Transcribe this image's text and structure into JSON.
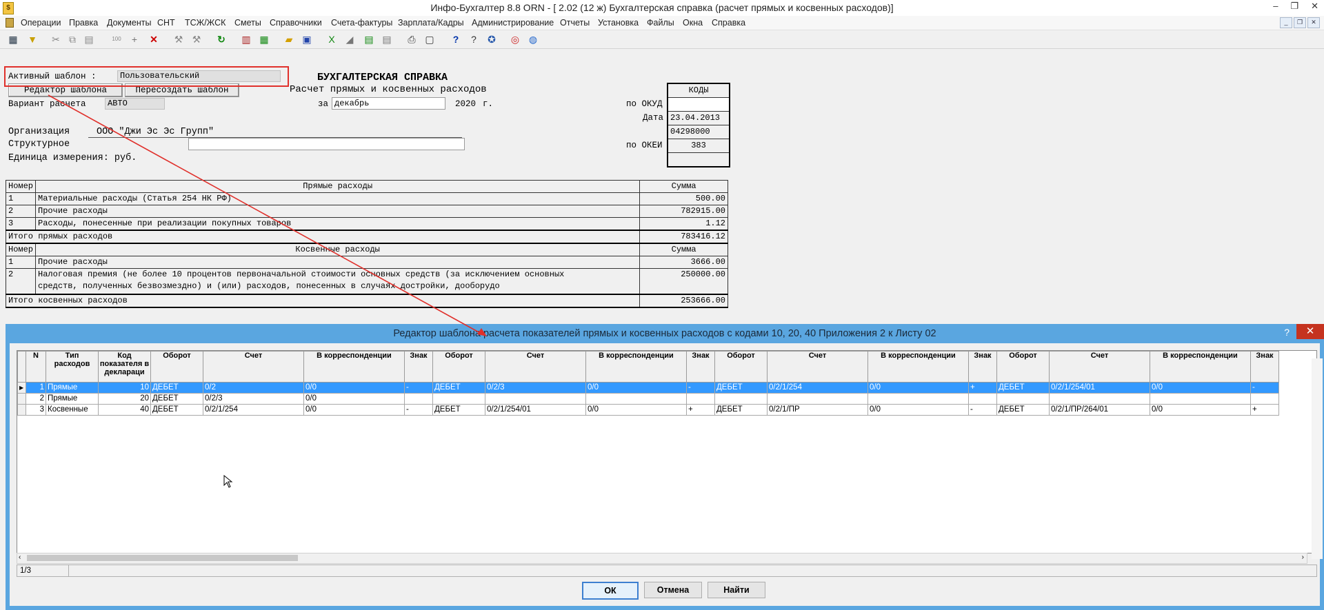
{
  "window": {
    "title": "Инфо-Бухгалтер 8.8   ORN   - [      2.02 (12 ж) Бухгалтерская справка (расчет прямых и косвенных расходов)]",
    "app_icon": "ledger-icon",
    "controls": [
      "_",
      "❐",
      "✕"
    ]
  },
  "menu": [
    "Операции",
    "Правка",
    "Документы",
    "СНТ",
    "ТСЖ/ЖСК",
    "Сметы",
    "Справочники",
    "Счета-фактуры",
    "Зарплата/Кадры",
    "Администрирование",
    "Отчеты",
    "Установка",
    "Файлы",
    "Окна",
    "Справка"
  ],
  "toolbar_icons": [
    "calc-icon",
    "filter-icon",
    "cut-icon",
    "copy-icon",
    "paste-icon",
    "number-icon",
    "add-icon",
    "delete-icon",
    "tool1-icon",
    "tool2-icon",
    "refresh-icon",
    "report-icon",
    "table-icon",
    "open-icon",
    "save-icon",
    "excel-icon",
    "chart-icon",
    "export-icon",
    "export2-icon",
    "print-icon",
    "preview-icon",
    "help-icon",
    "context-help-icon",
    "navigate-icon",
    "support-icon",
    "web-icon"
  ],
  "doc": {
    "template_label": "Активный шаблон :",
    "template_value": "Пользовательский",
    "btn_editor": "Редактор шаблона",
    "btn_recreate": "Пересоздать шаблон",
    "variant_label": "Вариант расчета",
    "variant_value": "АВТО",
    "heading": "БУХГАЛТЕРСКАЯ СПРАВКА",
    "subheading": "Расчет прямых и косвенных расходов",
    "period_prefix": "за",
    "period_month": "декабрь",
    "period_year": "2020",
    "period_suffix": "г.",
    "codes_header": "КОДЫ",
    "okud_label": "по ОКУД",
    "okud_value": "",
    "date_label": "Дата",
    "date_value": "23.04.2013",
    "code3_value": "04298000",
    "okei_label": "по ОКЕИ",
    "okei_value": "383",
    "org_label": "Организация",
    "org_value": "ООО \"Джи Эс Эс Групп\"",
    "struct_label": "Структурное",
    "unit_label": "Единица измерения: руб."
  },
  "direct": {
    "col_num": "Номер",
    "col_name": "Прямые расходы",
    "col_sum": "Сумма",
    "rows": [
      {
        "n": "1",
        "name": "Материальные расходы (Статья 254 НК РФ)",
        "sum": "500.00"
      },
      {
        "n": "2",
        "name": "Прочие расходы",
        "sum": "782915.00"
      },
      {
        "n": "3",
        "name": "Расходы, понесенные при реализации покупных товаров",
        "sum": "1.12"
      }
    ],
    "total_label": "Итого прямых расходов",
    "total_sum": "783416.12"
  },
  "indirect": {
    "col_num": "Номер",
    "col_name": "Косвенные расходы",
    "col_sum": "Сумма",
    "row1": {
      "n": "1",
      "name": "Прочие расходы",
      "sum": "3666.00"
    },
    "row2": {
      "n": "2",
      "name_line1": "Налоговая премия (не более 10 процентов первоначальной стоимости основных средств (за исключением основных",
      "name_line2": "средств, полученных безвозмездно) и (или) расходов, понесенных в случаях достройки, дооборудо",
      "sum": "250000.00"
    },
    "total_label": "Итого косвенных расходов",
    "total_sum": "253666.00"
  },
  "dialog": {
    "title": "Редактор шаблона расчета показателей прямых и косвенных расходов с кодами 10, 20, 40 Приложения 2 к Листу 02",
    "help": "?",
    "close": "✕",
    "columns": [
      "N",
      "Тип расходов",
      "Код показателя в деклараци",
      "Оборот",
      "Счет",
      "В корреспонденции",
      "Знак",
      "Оборот",
      "Счет",
      "В корреспонденции",
      "Знак",
      "Оборот",
      "Счет",
      "В корреспонденции",
      "Знак",
      "Оборот",
      "Счет",
      "В корреспонденции",
      "Знак"
    ],
    "rows": [
      [
        "1",
        "Прямые",
        "10",
        "ДЕБЕТ",
        "0/2",
        "0/0",
        "-",
        "ДЕБЕТ",
        "0/2/3",
        "0/0",
        "-",
        "ДЕБЕТ",
        "0/2/1/254",
        "0/0",
        "+",
        "ДЕБЕТ",
        "0/2/1/254/01",
        "0/0",
        "-"
      ],
      [
        "2",
        "Прямые",
        "20",
        "ДЕБЕТ",
        "0/2/3",
        "0/0",
        "",
        "",
        "",
        "",
        "",
        "",
        "",
        "",
        "",
        "",
        "",
        "",
        ""
      ],
      [
        "3",
        "Косвенные",
        "40",
        "ДЕБЕТ",
        "0/2/1/254",
        "0/0",
        "-",
        "ДЕБЕТ",
        "0/2/1/254/01",
        "0/0",
        "+",
        "ДЕБЕТ",
        "0/2/1/ПР",
        "0/0",
        "-",
        "ДЕБЕТ",
        "0/2/1/ПР/264/01",
        "0/0",
        "+"
      ]
    ],
    "selected_row": 0,
    "status": "1/3",
    "btn_ok": "ОК",
    "btn_cancel": "Отмена",
    "btn_find": "Найти"
  },
  "colors": {
    "accent": "#3399ff",
    "dialog_frame": "#5aa6e0",
    "highlight_box": "#e0302b",
    "arrow": "#e0302b"
  }
}
